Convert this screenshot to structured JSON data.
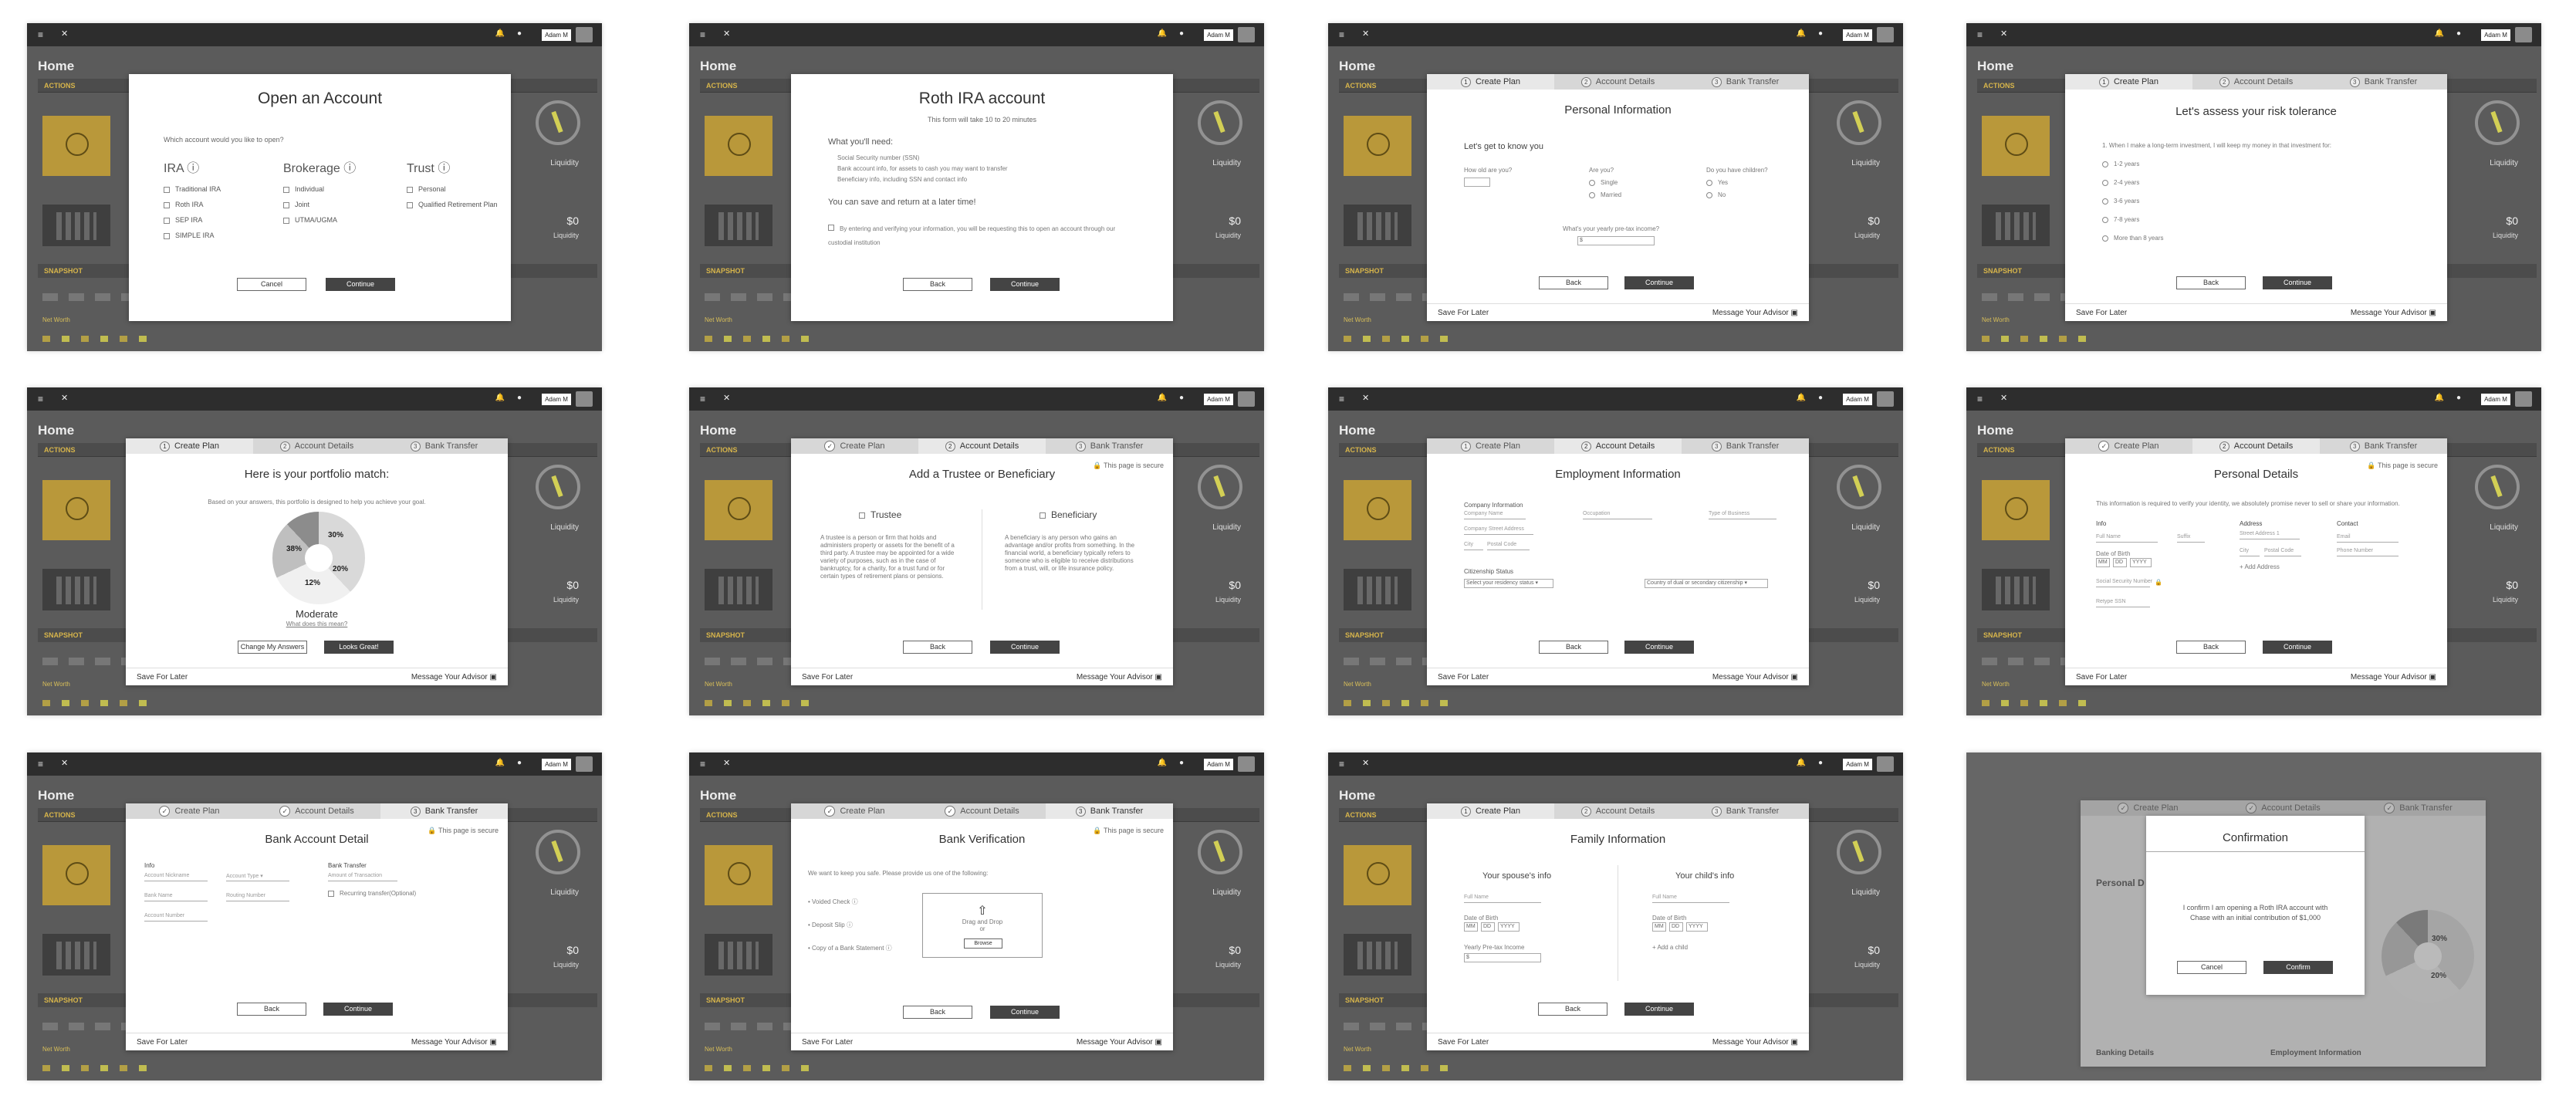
{
  "shared": {
    "menu": "≡",
    "logo": "✕",
    "bell": "🔔",
    "chat": "●",
    "user": "Adam M",
    "home": "Home",
    "actions": "ACTIONS",
    "liquidity": "Liquidity",
    "zero": "$0",
    "snapshot": "SNAPSHOT",
    "net_worth": "Net Worth"
  },
  "steps": {
    "create": "Create Plan",
    "account": "Account Details",
    "bank": "Bank Transfer"
  },
  "footer": {
    "save": "Save For Later",
    "advisor": "Message Your Advisor"
  },
  "lock": "This page is secure",
  "f1": {
    "title": "Open an Account",
    "question": "Which account would you like to open?",
    "cols": [
      {
        "title": "IRA",
        "items": [
          "Traditional IRA",
          "Roth IRA",
          "SEP IRA",
          "SIMPLE IRA"
        ]
      },
      {
        "title": "Brokerage",
        "items": [
          "Individual",
          "Joint",
          "UTMA/UGMA"
        ]
      },
      {
        "title": "Trust",
        "items": [
          "Personal",
          "Qualified Retirement Plan"
        ]
      }
    ],
    "cancel": "Cancel",
    "continue": "Continue"
  },
  "f2": {
    "title": "Roth IRA account",
    "sub": "This form will take 10 to 20 minutes",
    "need": "What you'll need:",
    "bullets": [
      "Social Security number (SSN)",
      "Bank account info, for assets to cash you may want to transfer",
      "Beneficiary info, including SSN and contact info"
    ],
    "later": "You can save and return at a later time!",
    "terms": "By entering and verifying your information, you will be requesting this to open an account through our custodial institution",
    "back": "Back",
    "continue": "Continue"
  },
  "f3": {
    "title": "Personal Information",
    "intro": "Let's get to know you",
    "age": "How old are you?",
    "are": "Are you?",
    "single": "Single",
    "married": "Married",
    "children": "Do you have children?",
    "yes": "Yes",
    "no": "No",
    "income": "What's your yearly pre-tax income?",
    "dollar": "$",
    "back": "Back",
    "continue": "Continue"
  },
  "f4": {
    "title": "Let's assess your risk tolerance",
    "question": "1. When I make a long-term investment, I will keep my money in that investment for:",
    "options": [
      "1-2 years",
      "2-4 years",
      "3-6 years",
      "7-8 years",
      "More than 8 years"
    ],
    "back": "Back",
    "continue": "Continue"
  },
  "f5": {
    "title": "Here is your portfolio match:",
    "sub": "Based on your answers, this portfolio is designed to help you achieve your goal.",
    "p38": "38%",
    "p30": "30%",
    "p20": "20%",
    "p12": "12%",
    "moderate": "Moderate",
    "mean": "What does this mean?",
    "change": "Change My Answers",
    "great": "Looks Great!"
  },
  "f6": {
    "title": "Add a Trustee or Beneficiary",
    "trustee": "Trustee",
    "beneficiary": "Beneficiary",
    "t_text": "A trustee is a person or firm that holds and administers property or assets for the benefit of a third party. A trustee may be appointed for a wide variety of purposes, such as in the case of bankruptcy, for a charity, for a trust fund or for certain types of retirement plans or pensions.",
    "b_text": "A beneficiary is any person who gains an advantage and/or profits from something. In the financial world, a beneficiary typically refers to someone who is eligible to receive distributions from a trust, will, or life insurance policy.",
    "back": "Back",
    "continue": "Continue"
  },
  "f7": {
    "title": "Employment Information",
    "company": "Company Information",
    "company_name": "Company Name",
    "occupation": "Occupation",
    "business": "Type of Business",
    "street": "Company Street Address",
    "city": "City",
    "postal": "Postal Code",
    "citizen": "Citizenship Status",
    "residency": "Select your residency status",
    "country": "Country of dual or secondary citizenship",
    "back": "Back",
    "continue": "Continue"
  },
  "f8": {
    "title": "Personal Details",
    "sub": "This information is required to verify your identity, we absolutely promise never to sell or share your information.",
    "info": "Info",
    "address": "Address",
    "contact": "Contact",
    "full": "Full Name",
    "suffix": "Suffix",
    "street": "Street Address 1",
    "email": "Email",
    "dob": "Date of Birth",
    "mm": "MM",
    "dd": "DD",
    "yyyy": "YYYY",
    "city": "City",
    "postal": "Postal Code",
    "phone": "Phone Number",
    "ssn": "Social Security Number",
    "addr": "+ Add Address",
    "retype": "Retype SSN",
    "back": "Back",
    "continue": "Continue"
  },
  "f9": {
    "title": "Bank Account Detail",
    "info": "Info",
    "nickname": "Account Nickname",
    "type": "Account Type",
    "bank": "Bank Name",
    "routing": "Routing Number",
    "number": "Account Number",
    "transfer": "Bank Transfer",
    "amount": "Amount of Transaction",
    "recurring": "Recurring transfer(Optional)",
    "back": "Back",
    "continue": "Continue"
  },
  "f10": {
    "title": "Bank Verification",
    "sub": "We want to keep you safe. Please provide us one of the following:",
    "options": [
      "Voided Check",
      "Deposit Slip",
      "Copy of a Bank Statement"
    ],
    "drag": "Drag and Drop",
    "or": "or",
    "browse": "Browse",
    "back": "Back",
    "continue": "Continue"
  },
  "f11": {
    "title": "Family Information",
    "spouse": "Your spouse's info",
    "child": "Your child's info",
    "full": "Full Name",
    "dob": "Date of Birth",
    "mm": "MM",
    "dd": "DD",
    "yyyy": "YYYY",
    "income": "Yearly Pre-tax Income",
    "dollar": "$",
    "add": "+ Add a child",
    "back": "Back",
    "continue": "Continue"
  },
  "f12": {
    "title": "Confirmation",
    "text1": "I confirm I am opening a Roth IRA account with",
    "text2": "Chase with an initial contribution of $1,000",
    "cancel": "Cancel",
    "confirm": "Confirm",
    "personal": "Personal D",
    "banking": "Banking Details",
    "employment": "Employment Information",
    "percent30": "30%",
    "percent20": "20%"
  }
}
